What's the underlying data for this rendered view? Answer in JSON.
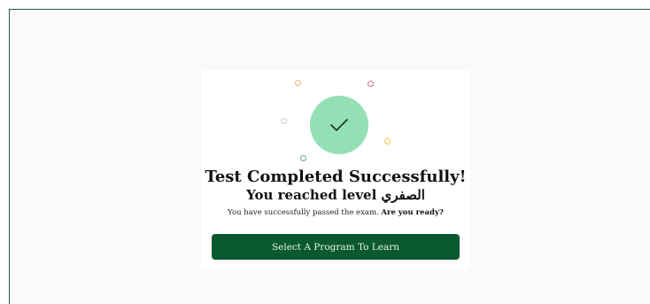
{
  "success": {
    "title": "Test Completed Successfully!",
    "level_prefix": "You reached level",
    "level_name": "الصفري",
    "message": "You have successfully passed the exam.",
    "message_emphasis": "Are you ready?",
    "cta_label": "Select A Program To Learn",
    "icon": "checkmark-icon",
    "colors": {
      "accent": "#0b5a2f",
      "check_circle": "#93e0b5",
      "frame_border": "#1b5e3a"
    }
  }
}
